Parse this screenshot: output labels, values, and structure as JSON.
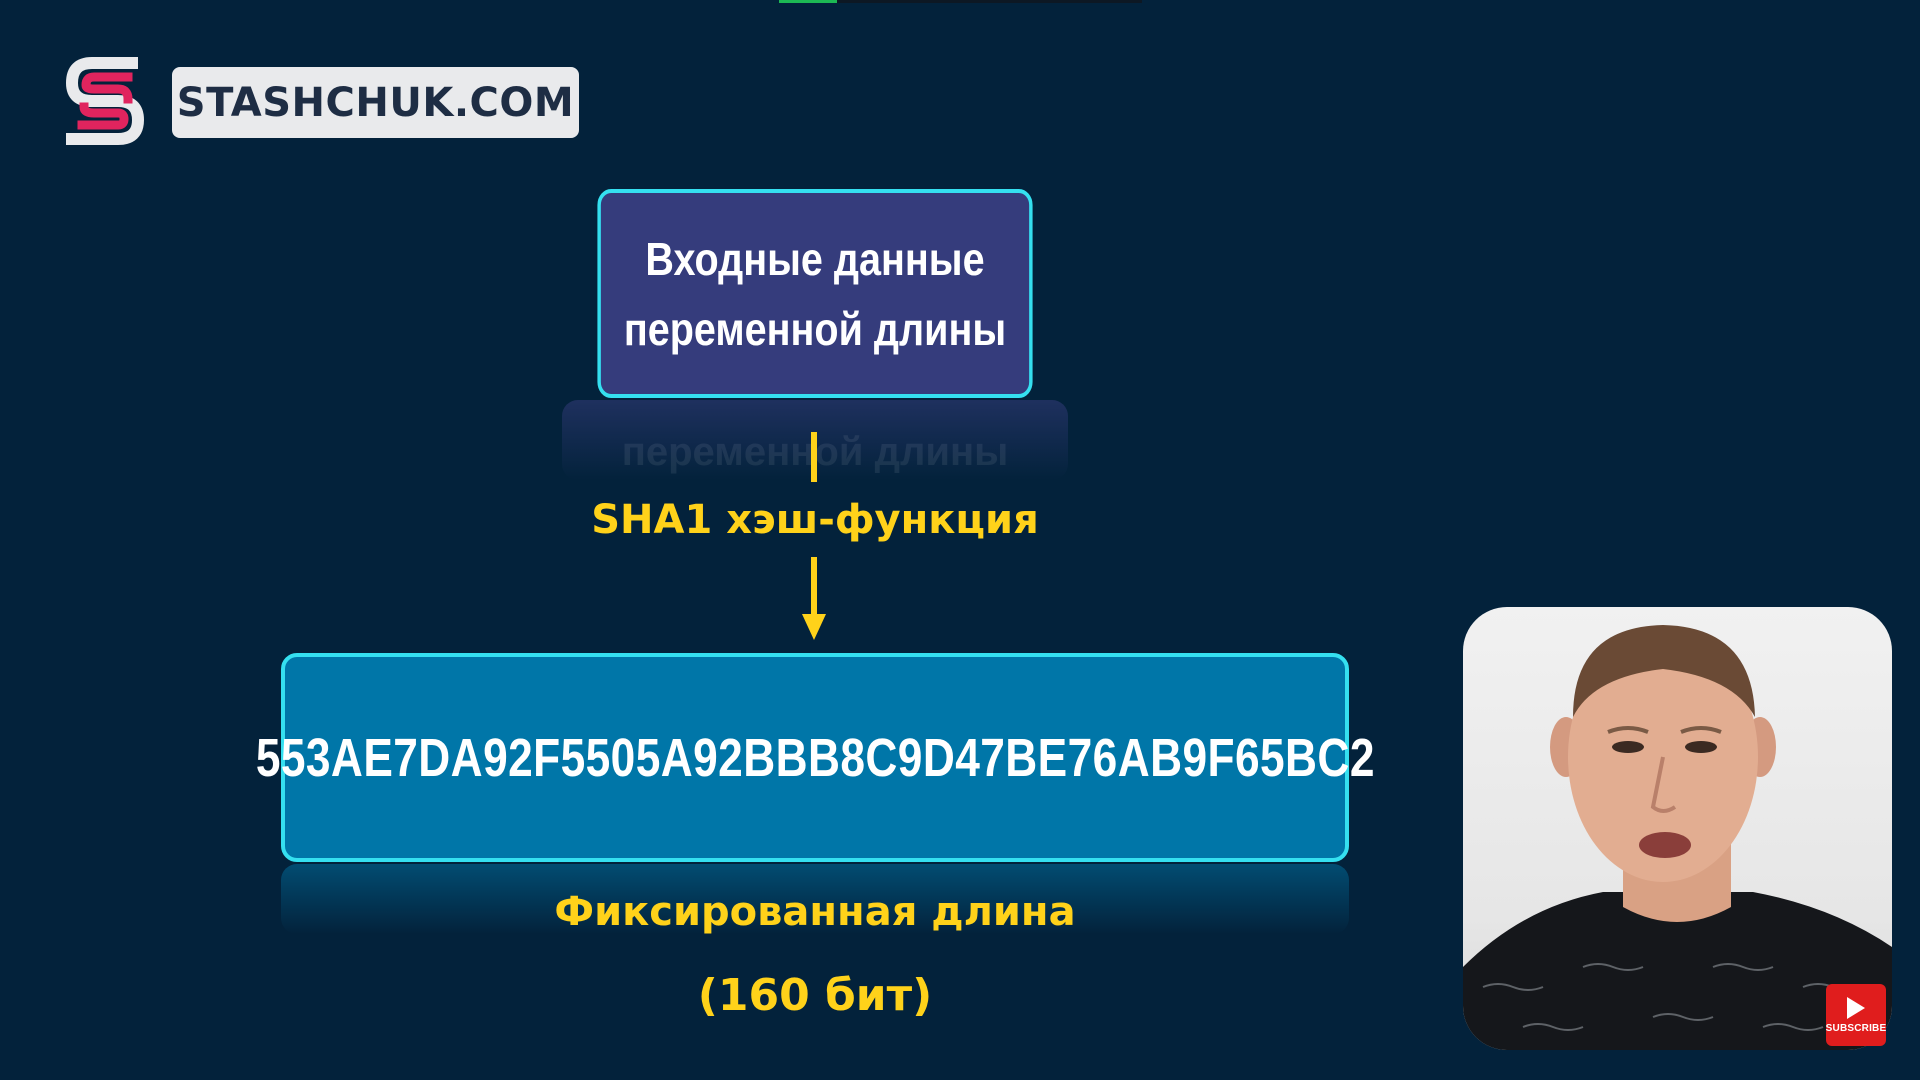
{
  "logo": {
    "text": "STASHCHUK.COM",
    "colors": {
      "magenta": "#e0245e",
      "white": "#ffffff",
      "plate": "#e9eaec",
      "text": "#1e2d44"
    }
  },
  "diagram": {
    "input_line1": "Входные данные",
    "input_line2": "переменной длины",
    "hash_function_label": "SHA1 хэш-функция",
    "output_hash": "553AE7DA92F5505A92BBB8C9D47BE76AB9F65BC2",
    "fixed_length_label": "Фиксированная длина",
    "bits_label": "(160 бит)"
  },
  "video": {
    "progress_fraction": 0.16,
    "subscribe_label": "SUBSCRIBE"
  },
  "colors": {
    "background": "#03223b",
    "input_box": "#353c7c",
    "output_box": "#0076a8",
    "box_border": "#35e0f0",
    "accent_yellow": "#ffd21a",
    "subscribe_red": "#e01d1d"
  },
  "icons": {
    "logo_mark": "stashchuk-s-logo-icon",
    "arrow": "arrow-down-icon",
    "subscribe": "youtube-play-icon"
  }
}
